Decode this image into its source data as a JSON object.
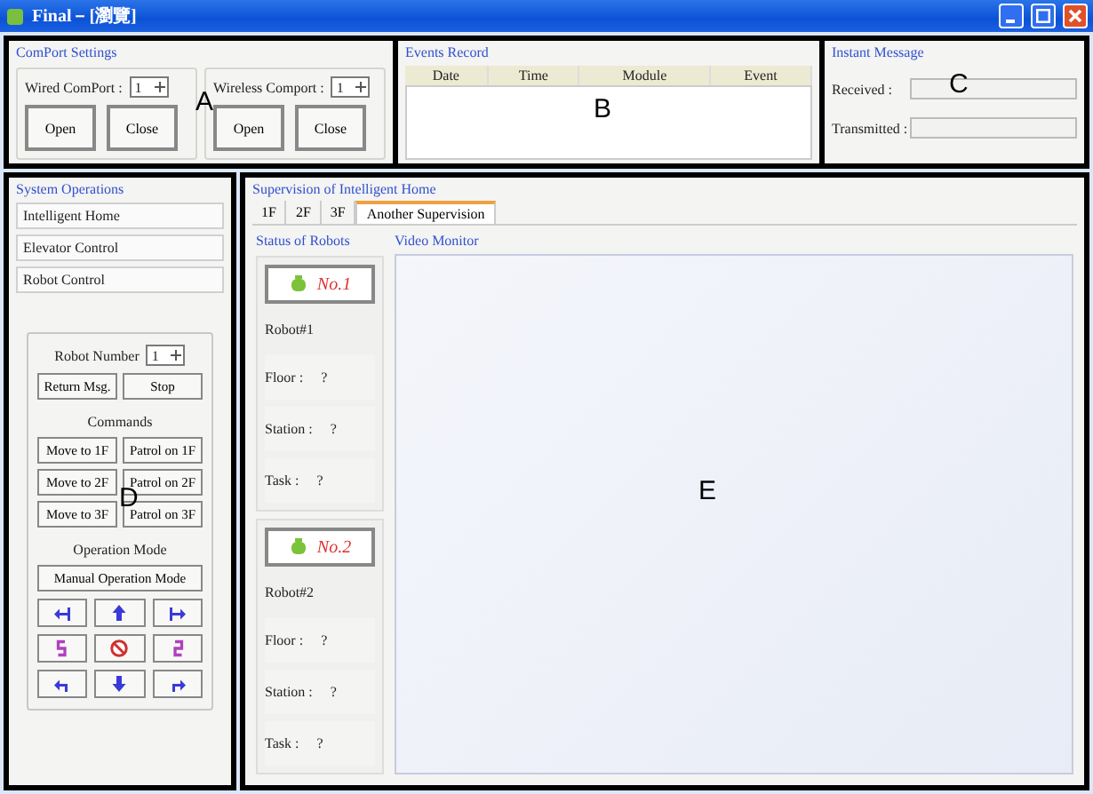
{
  "window": {
    "title": "Final－[瀏覽]"
  },
  "comport_settings": {
    "title": "ComPort Settings",
    "annotation": "A",
    "ports": [
      {
        "label": "Wired ComPort :",
        "value": "1",
        "buttons": [
          "Open",
          "Close"
        ]
      },
      {
        "label": "Wireless Comport :",
        "value": "1",
        "buttons": [
          "Open",
          "Close"
        ]
      }
    ]
  },
  "events_record": {
    "title": "Events Record",
    "annotation": "B",
    "columns": [
      "Date",
      "Time",
      "Module",
      "Event"
    ]
  },
  "instant_message": {
    "title": "Instant Message",
    "annotation": "C",
    "fields": [
      {
        "label": "Received :"
      },
      {
        "label": "Transmitted :"
      }
    ]
  },
  "system_operations": {
    "title": "System Operations",
    "annotation": "D",
    "items": [
      "Intelligent Home",
      "Elevator Control",
      "Robot Control"
    ],
    "robot_number": {
      "label": "Robot Number",
      "value": "1"
    },
    "actions": [
      "Return Msg.",
      "Stop"
    ],
    "commands_title": "Commands",
    "commands": [
      "Move to 1F",
      "Patrol on 1F",
      "Move to 2F",
      "Patrol on 2F",
      "Move to 3F",
      "Patrol on 3F"
    ],
    "mode_title": "Operation Mode",
    "mode_button": "Manual Operation Mode",
    "moves": [
      {
        "kind": "turn-left"
      },
      {
        "kind": "forward"
      },
      {
        "kind": "turn-right"
      },
      {
        "kind": "spin-left"
      },
      {
        "kind": "stop"
      },
      {
        "kind": "spin-right"
      },
      {
        "kind": "back-left"
      },
      {
        "kind": "backward"
      },
      {
        "kind": "back-right"
      }
    ]
  },
  "supervision": {
    "title": "Supervision of Intelligent Home",
    "annotation": "E",
    "tabs": [
      {
        "label": "1F",
        "selected": false
      },
      {
        "label": "2F",
        "selected": false
      },
      {
        "label": "3F",
        "selected": false
      },
      {
        "label": "Another Supervision",
        "selected": true
      }
    ],
    "status_title": "Status of Robots",
    "video_title": "Video Monitor",
    "robots": [
      {
        "button": "No.1",
        "name": "Robot#1",
        "rows": [
          {
            "label": "Floor :",
            "value": "?"
          },
          {
            "label": "Station :",
            "value": "?"
          },
          {
            "label": "Task :",
            "value": "?"
          }
        ]
      },
      {
        "button": "No.2",
        "name": "Robot#2",
        "rows": [
          {
            "label": "Floor :",
            "value": "?"
          },
          {
            "label": "Station :",
            "value": "?"
          },
          {
            "label": "Task :",
            "value": "?"
          }
        ]
      }
    ]
  }
}
